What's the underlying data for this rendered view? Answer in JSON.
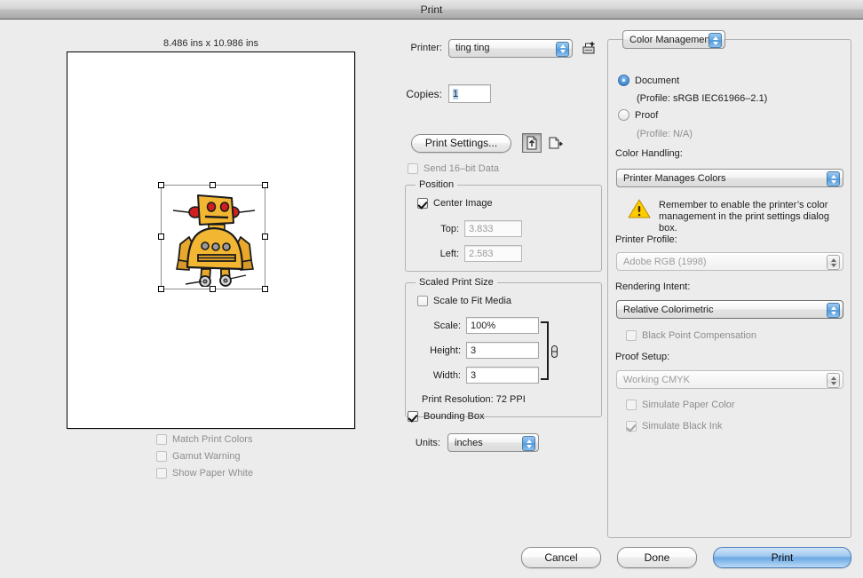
{
  "window": {
    "title": "Print"
  },
  "preview": {
    "dimensions_label": "8.486 ins x 10.986 ins",
    "artwork_name": "yellow-robot-illustration",
    "checkboxes": [
      {
        "label": "Match Print Colors",
        "checked": false,
        "enabled": false
      },
      {
        "label": "Gamut Warning",
        "checked": false,
        "enabled": false
      },
      {
        "label": "Show Paper White",
        "checked": false,
        "enabled": false
      }
    ]
  },
  "settings": {
    "printer_label": "Printer:",
    "printer_value": "ting ting",
    "printer_setup_icon": "printer-setup-icon",
    "copies_label": "Copies:",
    "copies_value": "1",
    "print_settings_button": "Print Settings...",
    "orientation_portrait_icon": "page-portrait-icon",
    "orientation_landscape_icon": "page-landscape-icon",
    "send_16bit_label": "Send 16–bit Data",
    "send_16bit_checked": false,
    "send_16bit_enabled": false,
    "position": {
      "title": "Position",
      "center_image_label": "Center Image",
      "center_image_checked": true,
      "top_label": "Top:",
      "top_value": "3.833",
      "left_label": "Left:",
      "left_value": "2.583"
    },
    "scaled_print_size": {
      "title": "Scaled Print Size",
      "scale_to_fit_label": "Scale to Fit Media",
      "scale_to_fit_checked": false,
      "scale_label": "Scale:",
      "scale_value": "100%",
      "height_label": "Height:",
      "height_value": "3",
      "width_label": "Width:",
      "width_value": "3",
      "link_icon": "chain-link-icon",
      "print_resolution": "Print Resolution: 72 PPI"
    },
    "bounding_box_label": "Bounding Box",
    "bounding_box_checked": true,
    "units_label": "Units:",
    "units_value": "inches"
  },
  "color_management": {
    "section_popup": "Color Management",
    "document_radio_label": "Document",
    "document_selected": true,
    "document_profile": "(Profile: sRGB IEC61966–2.1)",
    "proof_radio_label": "Proof",
    "proof_selected": false,
    "proof_profile": "(Profile: N/A)",
    "color_handling_label": "Color Handling:",
    "color_handling_value": "Printer Manages Colors",
    "warning_icon": "warning-triangle-icon",
    "warning_text": "Remember to enable the printer’s color management in the print settings dialog box.",
    "printer_profile_label": "Printer Profile:",
    "printer_profile_value": "Adobe RGB (1998)",
    "printer_profile_enabled": false,
    "rendering_intent_label": "Rendering Intent:",
    "rendering_intent_value": "Relative Colorimetric",
    "black_point_label": "Black Point Compensation",
    "black_point_checked": false,
    "black_point_enabled": false,
    "proof_setup_label": "Proof Setup:",
    "proof_setup_value": "Working CMYK",
    "proof_setup_enabled": false,
    "simulate_paper_label": "Simulate Paper Color",
    "simulate_paper_checked": false,
    "simulate_paper_enabled": false,
    "simulate_black_label": "Simulate Black Ink",
    "simulate_black_checked": true,
    "simulate_black_enabled": false
  },
  "footer": {
    "cancel": "Cancel",
    "done": "Done",
    "print": "Print"
  },
  "colors": {
    "accent_blue": "#6aa9e4",
    "window_bg": "#ececec",
    "robot_body": "#f2b632",
    "warning_yellow": "#ffcc00"
  }
}
